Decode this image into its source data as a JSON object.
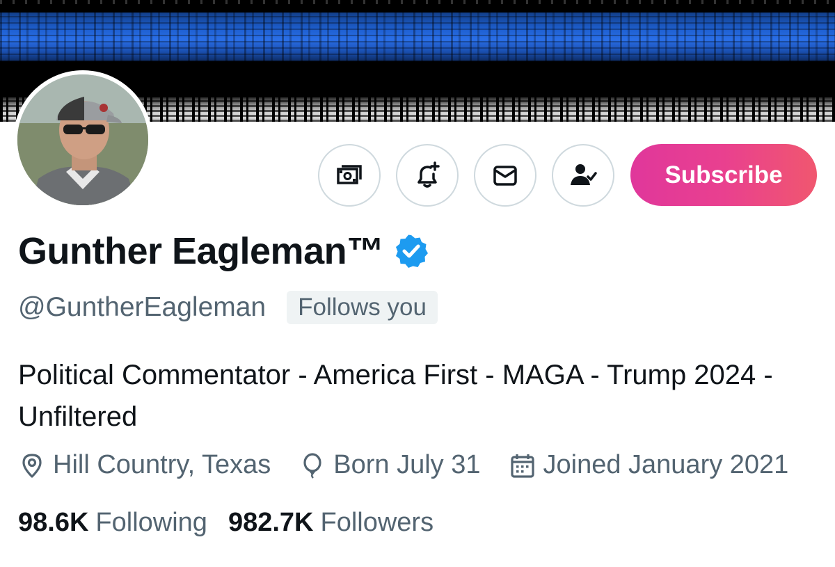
{
  "profile": {
    "display_name": "Gunther Eagleman™",
    "handle": "@GuntherEagleman",
    "follows_you": "Follows you",
    "bio": "Political Commentator - America First - MAGA - Trump 2024 - Unfiltered",
    "location": "Hill Country, Texas",
    "birthday": "Born July 31",
    "joined": "Joined January 2021"
  },
  "actions": {
    "subscribe_label": "Subscribe",
    "tip_icon": "money-icon",
    "notify_icon": "bell-plus-icon",
    "message_icon": "envelope-icon",
    "following_icon": "person-check-icon"
  },
  "stats": {
    "following_count": "98.6K",
    "following_label": "Following",
    "followers_count": "982.7K",
    "followers_label": "Followers"
  },
  "colors": {
    "verified": "#1d9bf0",
    "subscribe_start": "#e0379b",
    "subscribe_end": "#f0576f",
    "secondary_text": "#536471",
    "banner_blue": "#2a6fe8"
  }
}
